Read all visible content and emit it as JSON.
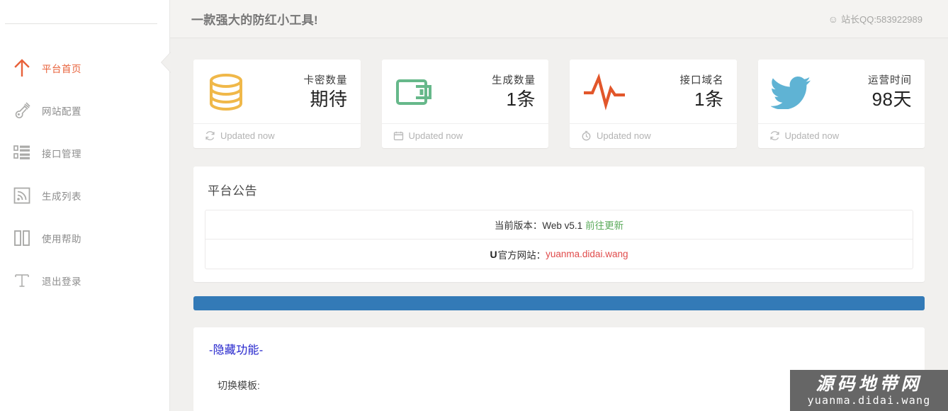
{
  "sidebar": {
    "items": [
      {
        "label": "平台首页",
        "icon": "up-arrow-icon",
        "active": true
      },
      {
        "label": "网站配置",
        "icon": "wrench-icon",
        "active": false
      },
      {
        "label": "接口管理",
        "icon": "list-blocks-icon",
        "active": false
      },
      {
        "label": "生成列表",
        "icon": "rss-feed-icon",
        "active": false
      },
      {
        "label": "使用帮助",
        "icon": "columns-icon",
        "active": false
      },
      {
        "label": "退出登录",
        "icon": "text-t-icon",
        "active": false
      }
    ]
  },
  "topbar": {
    "title": "一款强大的防红小工具!",
    "contact_icon": "smiley-face-icon",
    "contact": "站长QQ:583922989"
  },
  "cards": [
    {
      "title": "卡密数量",
      "value": "期待",
      "updated": "Updated now",
      "icon": "database-icon",
      "foot_icon": "refresh-icon",
      "color": "#f0b849"
    },
    {
      "title": "生成数量",
      "value": "1条",
      "updated": "Updated now",
      "icon": "wallet-icon",
      "foot_icon": "calendar-icon",
      "color": "#66b88a"
    },
    {
      "title": "接口域名",
      "value": "1条",
      "updated": "Updated now",
      "icon": "pulse-icon",
      "foot_icon": "clock-icon",
      "color": "#e2562a"
    },
    {
      "title": "运营时间",
      "value": "98天",
      "updated": "Updated now",
      "icon": "twitter-bird-icon",
      "foot_icon": "refresh-icon",
      "color": "#5fb3d4"
    }
  ],
  "announcement": {
    "heading": "平台公告",
    "rows": [
      {
        "prefix": "当前版本：Web v5.1",
        "link": "前往更新",
        "link_color": "#5cab5c"
      },
      {
        "mark": "U",
        "prefix": "官方网站：",
        "link": "yuanma.didai.wang",
        "link_color": "#e04b4b"
      }
    ]
  },
  "hidden_panel": {
    "title": "-隐藏功能-",
    "switch_label": "切换模板:"
  },
  "watermark": {
    "cn": "源码地带网",
    "en": "yuanma.didai.wang"
  },
  "colors": {
    "accent": "#e8613a",
    "primary_bar": "#337ab7",
    "page_bg": "#f1f0ee"
  }
}
